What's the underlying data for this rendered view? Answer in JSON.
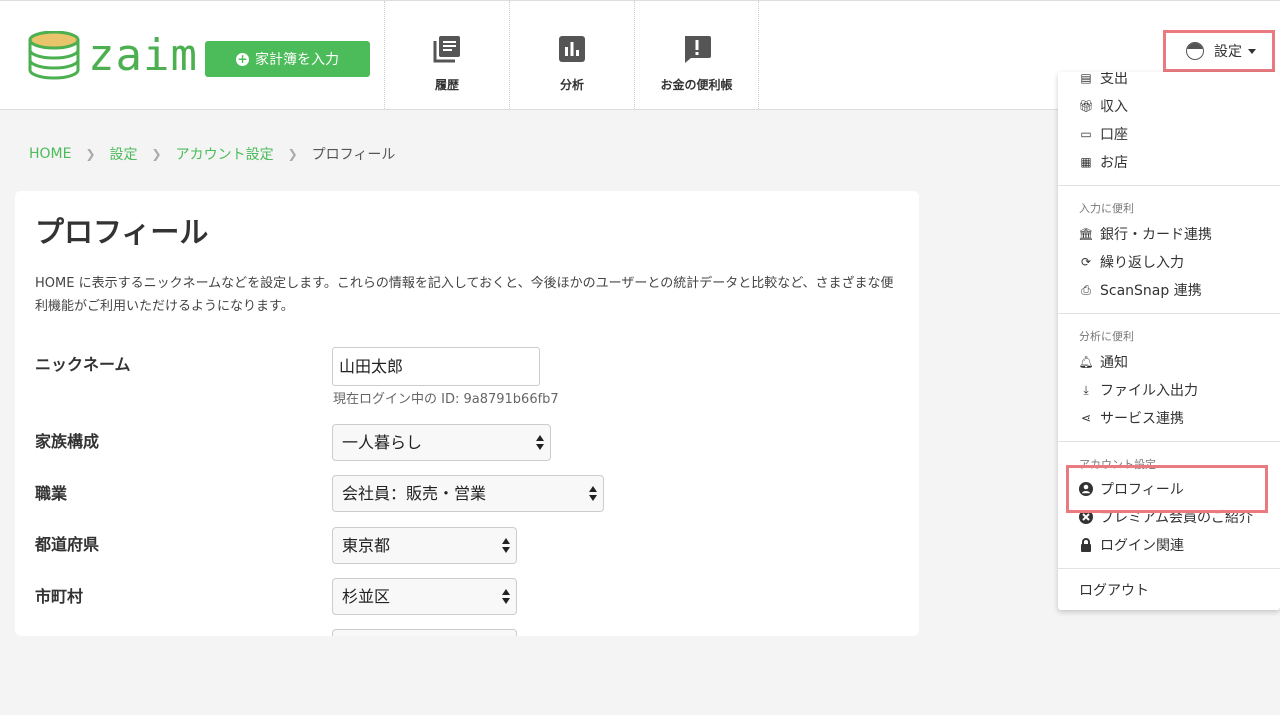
{
  "header": {
    "logo_text": "zaim",
    "input_button_label": "家計簿を入力",
    "nav": [
      {
        "label": "履歴",
        "icon": "history-book-icon"
      },
      {
        "label": "分析",
        "icon": "bar-chart-icon"
      },
      {
        "label": "お金の便利帳",
        "icon": "exclamation-chat-icon"
      }
    ],
    "settings_label": "設定"
  },
  "breadcrumb": {
    "items": [
      "HOME",
      "設定",
      "アカウント設定"
    ],
    "current": "プロフィール"
  },
  "profile": {
    "title": "プロフィール",
    "description": "HOME に表示するニックネームなどを設定します。これらの情報を記入しておくと、今後ほかのユーザーとの統計データと比較など、さまざまな便利機能がご利用いただけるようになります。",
    "nickname_label": "ニックネーム",
    "nickname_value": "山田太郎",
    "login_id_hint": "現在ログイン中の ID: 9a8791b66fb7",
    "family_label": "家族構成",
    "family_value": "一人暮らし",
    "job_label": "職業",
    "job_value": "会社員：販売・営業",
    "prefecture_label": "都道府県",
    "prefecture_value": "東京都",
    "city_label": "市町村",
    "city_value": "杉並区"
  },
  "menu": {
    "items_top": [
      {
        "label": "支出",
        "icon": "expense-icon"
      },
      {
        "label": "収入",
        "icon": "income-gift-icon"
      },
      {
        "label": "口座",
        "icon": "credit-card-icon"
      },
      {
        "label": "お店",
        "icon": "store-icon"
      }
    ],
    "section_input": "入力に便利",
    "items_input": [
      {
        "label": "銀行・カード連携",
        "icon": "bank-icon"
      },
      {
        "label": "繰り返し入力",
        "icon": "repeat-icon"
      },
      {
        "label": "ScanSnap 連携",
        "icon": "printer-icon"
      }
    ],
    "section_analysis": "分析に便利",
    "items_analysis": [
      {
        "label": "通知",
        "icon": "bell-icon"
      },
      {
        "label": "ファイル入出力",
        "icon": "download-icon"
      },
      {
        "label": "サービス連携",
        "icon": "share-icon"
      }
    ],
    "section_account": "アカウント設定",
    "items_account": [
      {
        "label": "プロフィール",
        "icon": "user-circle-icon"
      },
      {
        "label": "プレミアム会員のご紹介",
        "icon": "premium-icon"
      },
      {
        "label": "ログイン関連",
        "icon": "lock-icon"
      }
    ],
    "logout": "ログアウト"
  },
  "colors": {
    "brand_green": "#4cbb5a",
    "highlight_red": "#e87a80"
  }
}
